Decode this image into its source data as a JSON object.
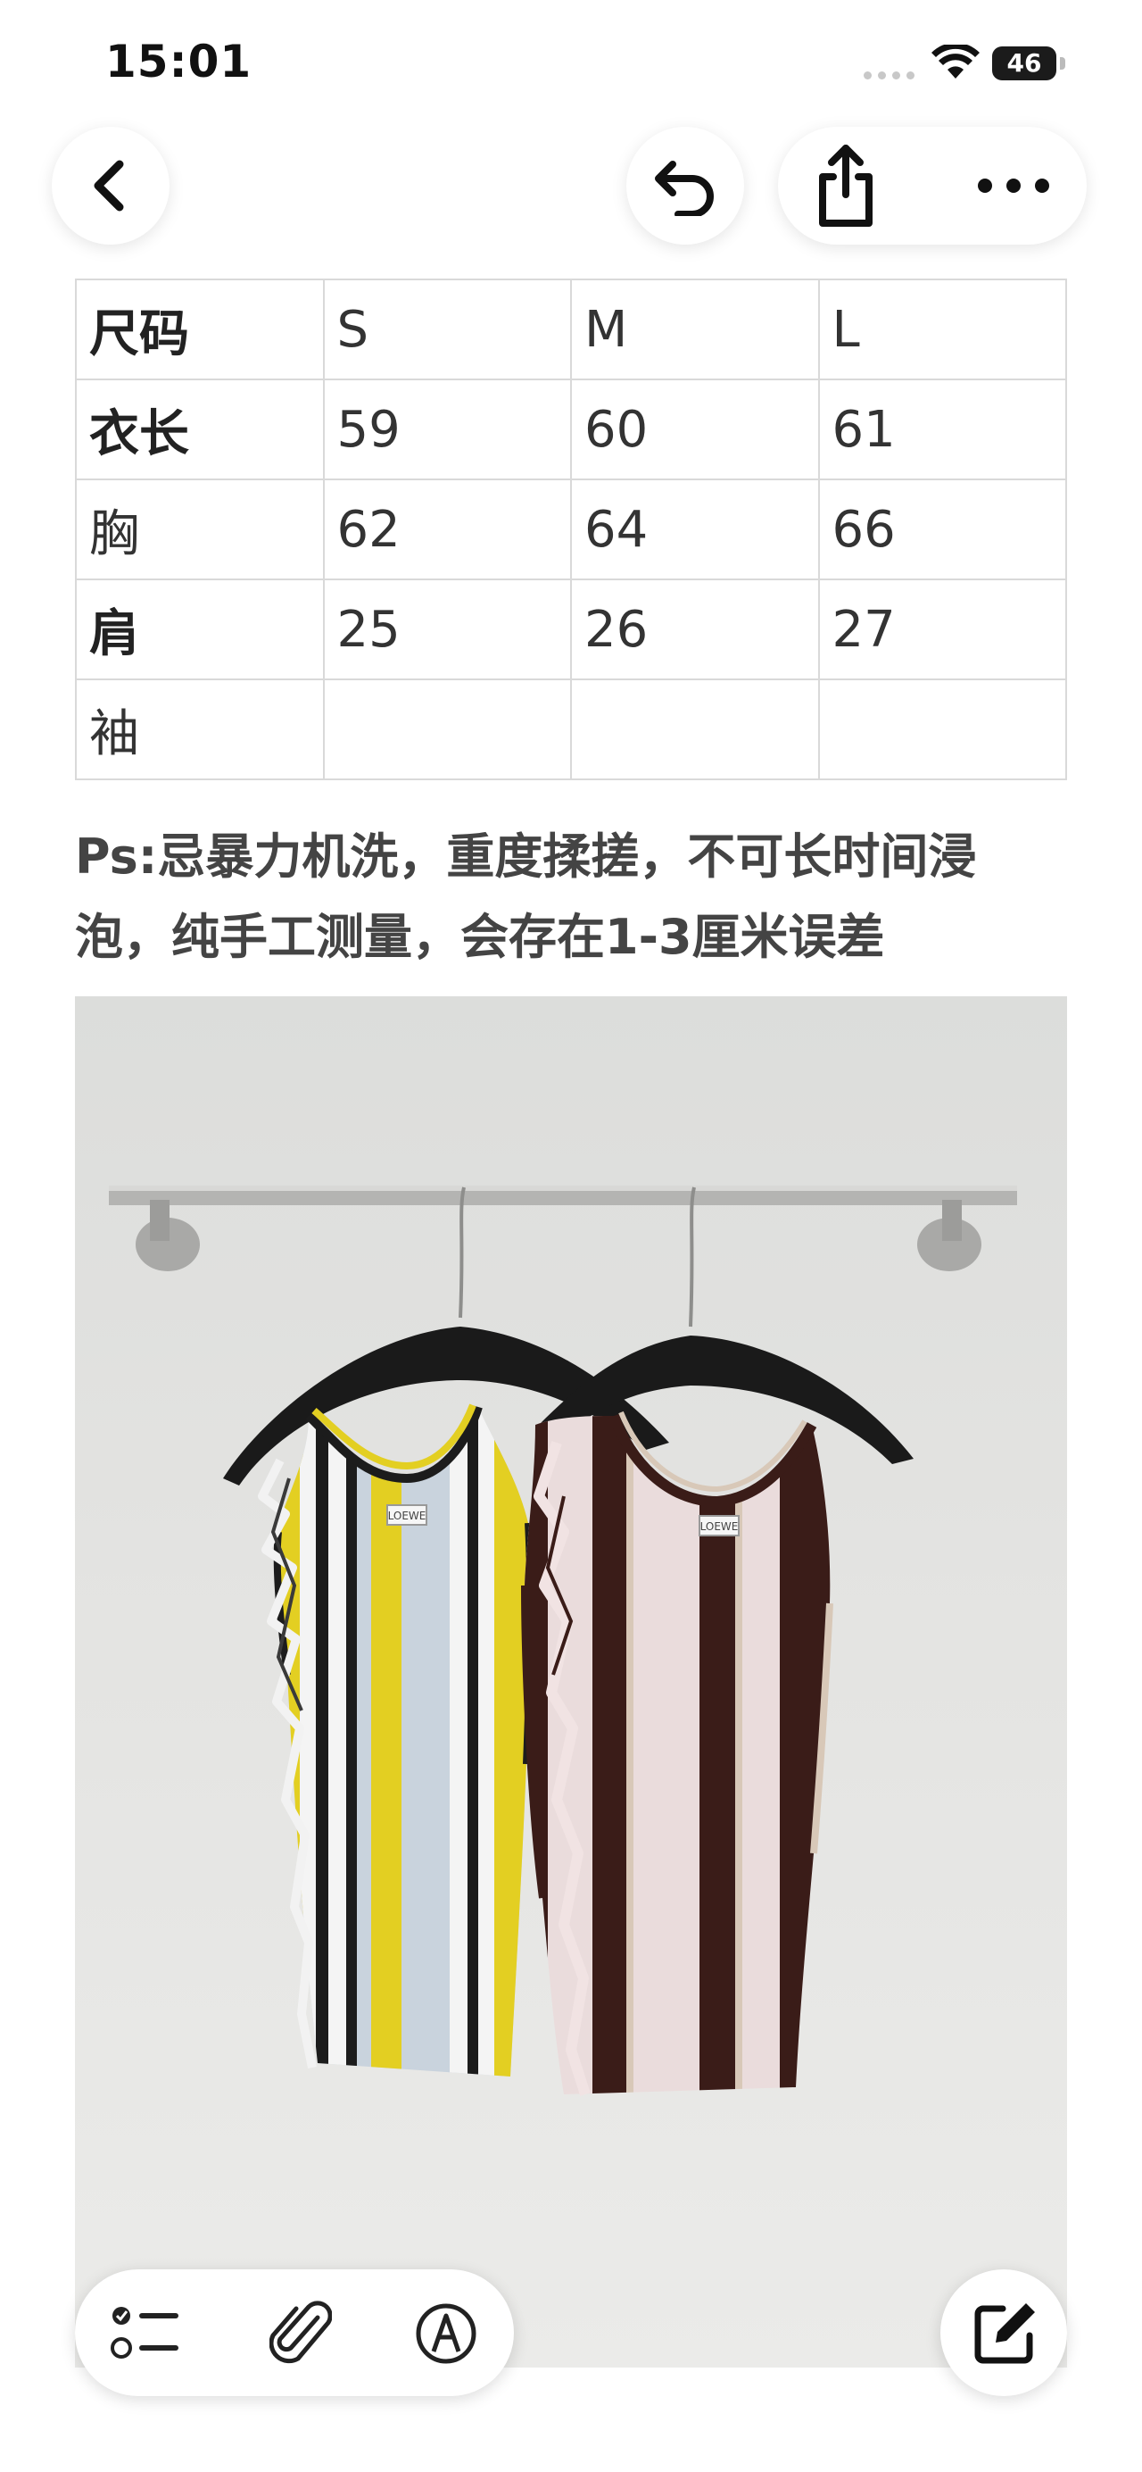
{
  "status_bar": {
    "time": "15:01",
    "battery": "46"
  },
  "nav": {
    "back_icon": "chevron-left-icon",
    "undo_icon": "undo-icon",
    "share_icon": "share-icon",
    "more_icon": "ellipsis-icon"
  },
  "size_table": {
    "header": [
      "尺码",
      "S",
      "M",
      "L"
    ],
    "rows": [
      [
        "衣长",
        "59",
        "60",
        "61"
      ],
      [
        "胸",
        "62",
        "64",
        "66"
      ],
      [
        "肩",
        "25",
        "26",
        "27"
      ],
      [
        "袖",
        "",
        "",
        ""
      ]
    ]
  },
  "note": {
    "line1": "Ps:忌暴力机洗，重度揉搓，不可长时间浸",
    "line2": "泡，纯手工测量，会存在1-3厘米误差"
  },
  "photo": {
    "label_left": "LOEWE",
    "label_right": "LOEWE",
    "colors": {
      "yellow": "#e3cf22",
      "light_blue": "#c9d3dd",
      "dark_brown": "#3a1c18",
      "pink": "#eadcdc"
    }
  },
  "toolbar": {
    "checklist_icon": "checklist-icon",
    "attachment_icon": "paperclip-icon",
    "markup_icon": "pen-tip-icon",
    "compose_icon": "compose-icon"
  }
}
